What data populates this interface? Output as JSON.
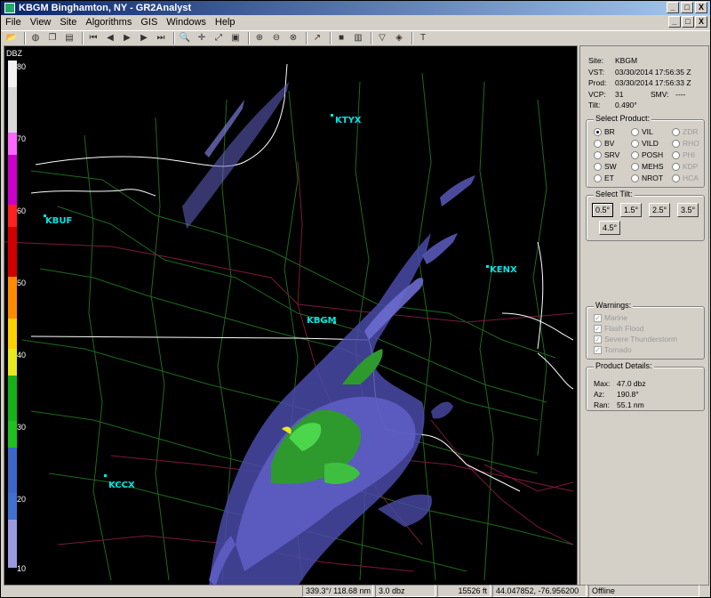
{
  "window": {
    "title": "KBGM Binghamton, NY - GR2Analyst",
    "min": "_",
    "max": "□",
    "close": "X"
  },
  "menu": [
    "File",
    "View",
    "Site",
    "Algorithms",
    "GIS",
    "Windows",
    "Help"
  ],
  "colorbar": {
    "title": "DBZ",
    "ticks": [
      "80",
      "70",
      "60",
      "50",
      "40",
      "30",
      "20",
      "10"
    ]
  },
  "sites": [
    {
      "name": "KTYX"
    },
    {
      "name": "KBUF"
    },
    {
      "name": "KENX"
    },
    {
      "name": "KBGM"
    },
    {
      "name": "KCCX"
    }
  ],
  "info": {
    "site_label": "Site:",
    "site": "KBGM",
    "vst_label": "VST:",
    "vst": "03/30/2014  17:56:35 Z",
    "prod_label": "Prod:",
    "prod": "03/30/2014  17:56:33 Z",
    "vcp_label": "VCP:",
    "vcp": "31",
    "smv_label": "SMV:",
    "smv": "----",
    "tilt_label": "Tilt:",
    "tilt": "0.490°"
  },
  "select_product": {
    "label": "Select Product:",
    "col1": [
      "BR",
      "BV",
      "SRV",
      "SW",
      "ET"
    ],
    "col2": [
      "VIL",
      "VILD",
      "POSH",
      "MEHS",
      "NROT"
    ],
    "col3": [
      "ZDR",
      "RHO",
      "PHI",
      "KDP",
      "HCA"
    ],
    "selected": "BR"
  },
  "select_tilt": {
    "label": "Select Tilt:",
    "tilts": [
      "0.5°",
      "1.5°",
      "2.5°",
      "3.5°",
      "4.5°"
    ],
    "selected": "0.5°"
  },
  "warnings": {
    "label": "Warnings:",
    "items": [
      "Marine",
      "Flash Flood",
      "Severe Thunderstorm",
      "Tornado"
    ]
  },
  "product_details": {
    "label": "Product Details:",
    "max_label": "Max:",
    "max": "47.0 dbz",
    "az_label": "Az:",
    "az": "190.8°",
    "ran_label": "Ran:",
    "ran": "55.1 nm"
  },
  "status": {
    "position": "339.3°/ 118.68 nm",
    "value": "3.0 dbz",
    "elevation": "15526 ft",
    "latlon": "44.047852, -76.956200",
    "mode": "Offline"
  }
}
